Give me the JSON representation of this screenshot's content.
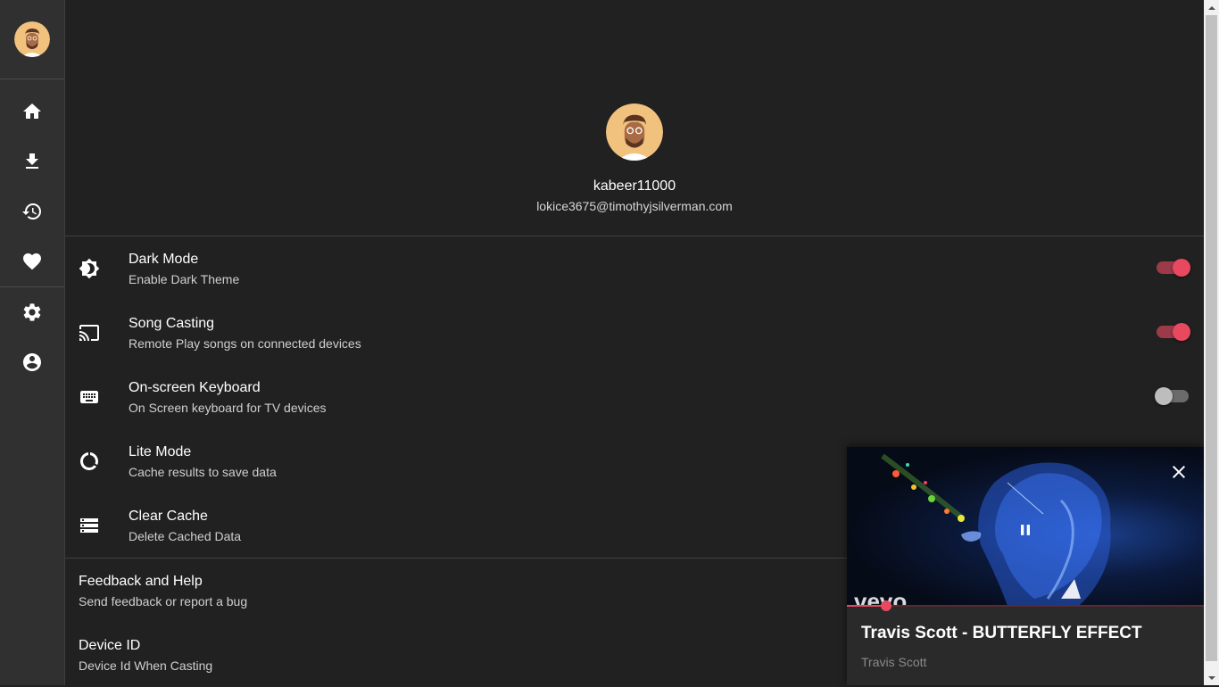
{
  "sidebar": {
    "avatar": "user-avatar",
    "nav": [
      {
        "name": "home",
        "icon": "home-icon"
      },
      {
        "name": "downloads",
        "icon": "download-icon"
      },
      {
        "name": "history",
        "icon": "history-icon"
      },
      {
        "name": "favorites",
        "icon": "heart-icon"
      },
      {
        "name": "settings",
        "icon": "gear-icon"
      },
      {
        "name": "account",
        "icon": "account-circle-icon"
      }
    ]
  },
  "profile": {
    "username": "kabeer11000",
    "email": "lokice3675@timothyjsilverman.com"
  },
  "settings": [
    {
      "title": "Dark Mode",
      "subtitle": "Enable Dark Theme",
      "icon": "brightness-icon",
      "enabled": true
    },
    {
      "title": "Song Casting",
      "subtitle": "Remote Play songs on connected devices",
      "icon": "cast-icon",
      "enabled": true
    },
    {
      "title": "On-screen Keyboard",
      "subtitle": "On Screen keyboard for TV devices",
      "icon": "keyboard-icon",
      "enabled": false
    },
    {
      "title": "Lite Mode",
      "subtitle": "Cache results to save data",
      "icon": "data-saver-icon"
    },
    {
      "title": "Clear Cache",
      "subtitle": "Delete Cached Data",
      "icon": "storage-icon"
    }
  ],
  "other": [
    {
      "title": "Feedback and Help",
      "subtitle": "Send feedback or report a bug"
    },
    {
      "title": "Device ID",
      "subtitle": "Device Id When Casting"
    }
  ],
  "player": {
    "title": "Travis Scott - BUTTERFLY EFFECT",
    "artist": "Travis Scott",
    "progress_fraction": 0.11,
    "state": "playing"
  },
  "colors": {
    "accent": "#e8495f",
    "background": "#212121",
    "sidebar": "#303030"
  }
}
